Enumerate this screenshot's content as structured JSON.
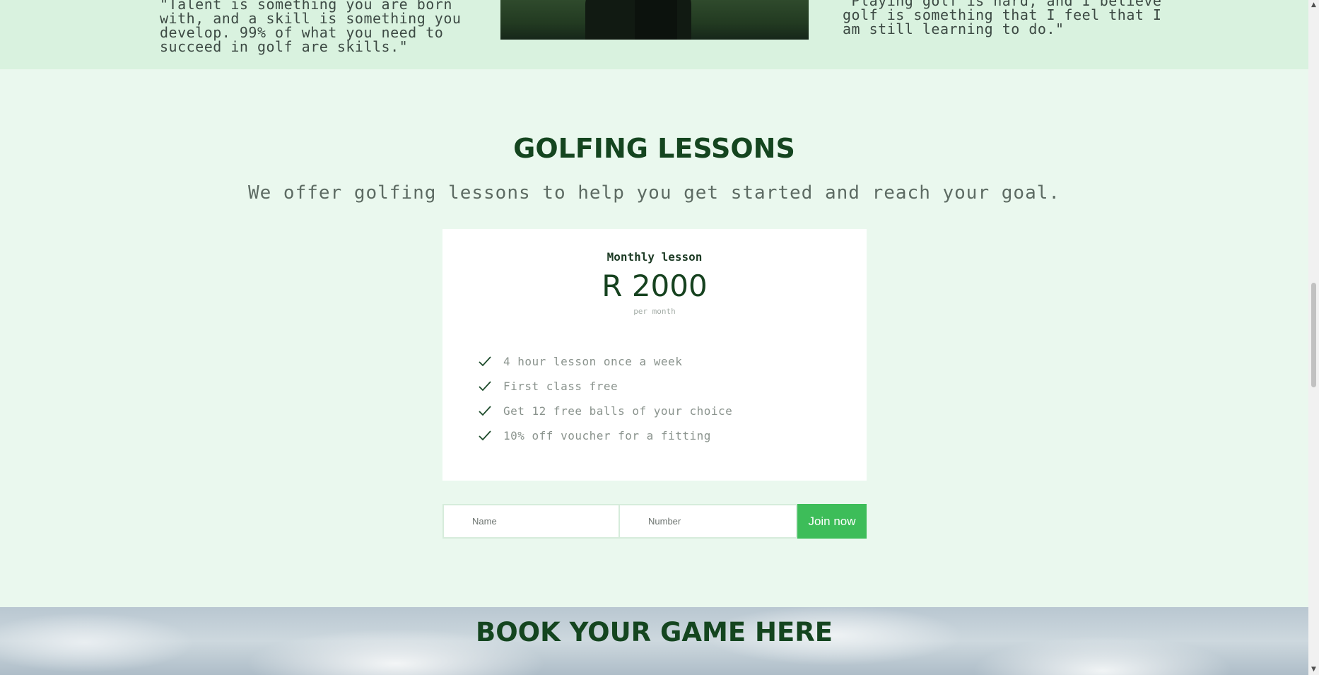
{
  "testimonials": {
    "left_quote": "\"Talent is something you are born with, and a skill is something you develop. 99% of what you need to succeed in golf are skills.\"",
    "right_quote": "\"Playing golf is hard, and I believe golf is something that I feel that I am still learning to do.\""
  },
  "lessons": {
    "title": "GOLFING LESSONS",
    "subtitle": "We offer golfing lessons to help you get started and reach your goal.",
    "plan": {
      "name": "Monthly lesson",
      "price": "R 2000",
      "period": "per month",
      "features": [
        "4 hour lesson once a week",
        "First class free",
        "Get 12 free balls of your choice",
        "10% off voucher for a fitting"
      ]
    },
    "form": {
      "name_placeholder": "Name",
      "number_placeholder": "Number",
      "submit_label": "Join now"
    }
  },
  "book": {
    "title": "BOOK YOUR GAME HERE"
  },
  "colors": {
    "accent_green": "#3dbd59",
    "heading_green": "#14451f",
    "section_bg": "#eaf8ee",
    "strip_bg": "#d9f2df"
  },
  "icons": {
    "feature_icon": "checkmark-icon"
  }
}
